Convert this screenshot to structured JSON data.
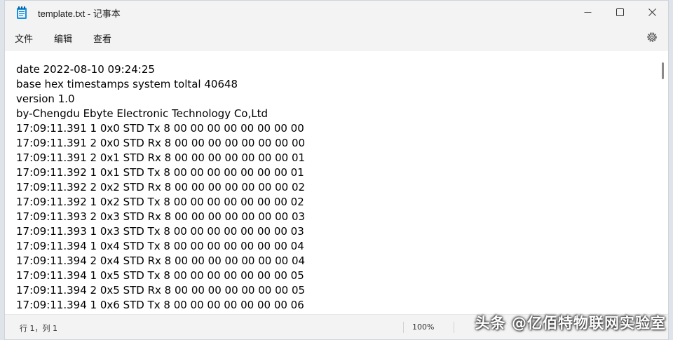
{
  "window": {
    "title": "template.txt - 记事本",
    "minimize_icon": "minimize-icon",
    "maximize_icon": "maximize-icon",
    "close_icon": "close-icon"
  },
  "menu": {
    "items": [
      {
        "label": "文件"
      },
      {
        "label": "编辑"
      },
      {
        "label": "查看"
      }
    ],
    "settings_icon": "gear-icon"
  },
  "editor": {
    "lines": [
      "date 2022-08-10 09:24:25",
      "base hex timestamps system toltal 40648",
      "version 1.0",
      "by-Chengdu Ebyte Electronic Technology Co,Ltd",
      "17:09:11.391 1 0x0 STD Tx 8 00 00 00 00 00 00 00 00",
      "17:09:11.391 2 0x0 STD Rx 8 00 00 00 00 00 00 00 00",
      "17:09:11.391 2 0x1 STD Rx 8 00 00 00 00 00 00 00 01",
      "17:09:11.392 1 0x1 STD Tx 8 00 00 00 00 00 00 00 01",
      "17:09:11.392 2 0x2 STD Rx 8 00 00 00 00 00 00 00 02",
      "17:09:11.392 1 0x2 STD Tx 8 00 00 00 00 00 00 00 02",
      "17:09:11.393 2 0x3 STD Rx 8 00 00 00 00 00 00 00 03",
      "17:09:11.393 1 0x3 STD Tx 8 00 00 00 00 00 00 00 03",
      "17:09:11.394 1 0x4 STD Tx 8 00 00 00 00 00 00 00 04",
      "17:09:11.394 2 0x4 STD Rx 8 00 00 00 00 00 00 00 04",
      "17:09:11.394 1 0x5 STD Tx 8 00 00 00 00 00 00 00 05",
      "17:09:11.394 2 0x5 STD Rx 8 00 00 00 00 00 00 00 05",
      "17:09:11.394 1 0x6 STD Tx 8 00 00 00 00 00 00 00 06"
    ]
  },
  "status": {
    "position": "行 1，列 1",
    "zoom": "100%"
  },
  "watermark": "头条 @亿佰特物联网实验室",
  "colors": {
    "chrome": "#f3f3f3",
    "editor_bg": "#ffffff",
    "app_icon": "#1e8fd9"
  }
}
